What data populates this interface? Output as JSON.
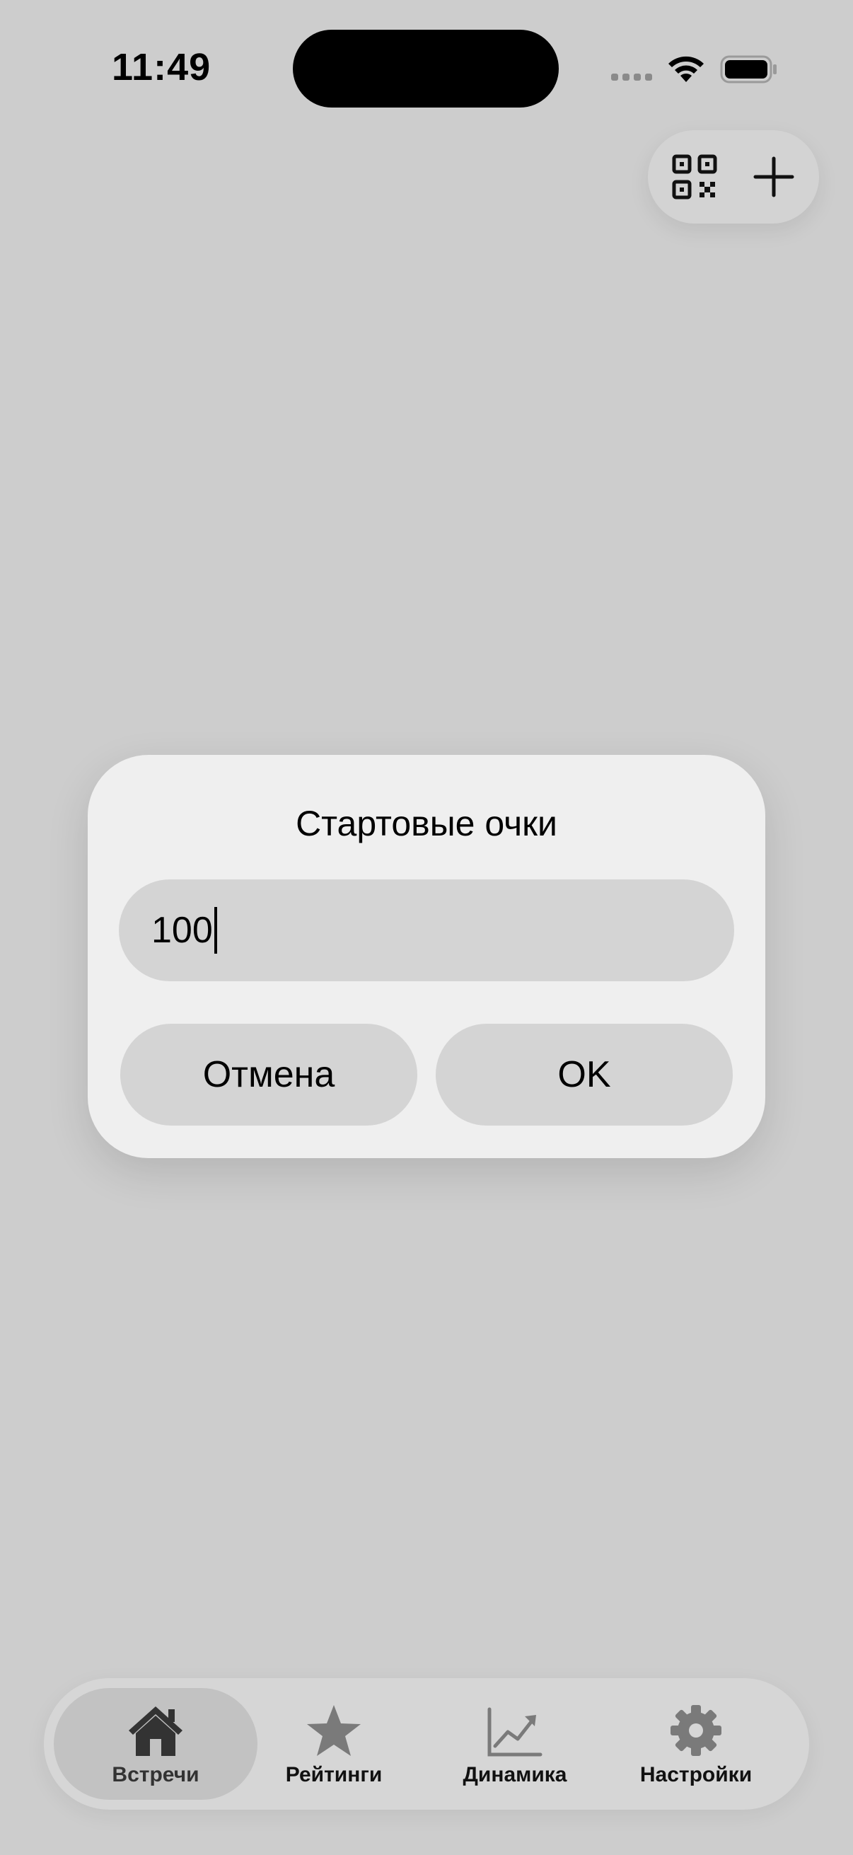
{
  "status_bar": {
    "time": "11:49"
  },
  "dialog": {
    "title": "Стартовые очки",
    "input_value": "100",
    "cancel_label": "Отмена",
    "ok_label": "OK"
  },
  "tabbar": {
    "items": [
      {
        "label": "Встречи",
        "icon": "house-icon",
        "active": true
      },
      {
        "label": "Рейтинги",
        "icon": "star-icon",
        "active": false
      },
      {
        "label": "Динамика",
        "icon": "chart-line-icon",
        "active": false
      },
      {
        "label": "Настройки",
        "icon": "gear-icon",
        "active": false
      }
    ]
  },
  "colors": {
    "background": "#cdcdcd",
    "dialog_bg": "#efefef",
    "control_bg": "#d4d4d4",
    "icon_dark": "#333333",
    "icon_gray": "#7a7a7a"
  }
}
